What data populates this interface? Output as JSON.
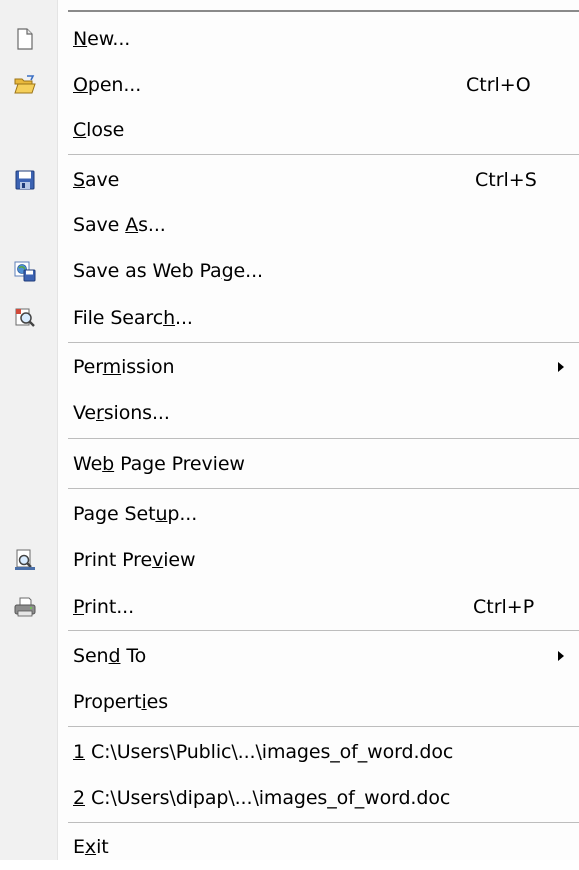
{
  "menu": {
    "items": [
      {
        "id": "new",
        "pre": "",
        "u": "N",
        "post": "ew...",
        "shortcut": "",
        "icon": "new-document-icon",
        "submenu": false
      },
      {
        "id": "open",
        "pre": "",
        "u": "O",
        "post": "pen...",
        "shortcut": "Ctrl+O",
        "icon": "open-folder-icon",
        "submenu": false
      },
      {
        "id": "close",
        "pre": "",
        "u": "C",
        "post": "lose",
        "shortcut": "",
        "icon": "",
        "submenu": false
      },
      {
        "id": "save",
        "pre": "",
        "u": "S",
        "post": "ave",
        "shortcut": "Ctrl+S",
        "icon": "save-disk-icon",
        "submenu": false
      },
      {
        "id": "save-as",
        "pre": "Save ",
        "u": "A",
        "post": "s...",
        "shortcut": "",
        "icon": "",
        "submenu": false
      },
      {
        "id": "save-as-web-page",
        "pre": "Save as Web Pa",
        "u": "g",
        "post": "e...",
        "shortcut": "",
        "icon": "save-web-page-icon",
        "submenu": false
      },
      {
        "id": "file-search",
        "pre": "File Searc",
        "u": "h",
        "post": "...",
        "shortcut": "",
        "icon": "file-search-icon",
        "submenu": false
      },
      {
        "id": "permission",
        "pre": "Per",
        "u": "m",
        "post": "ission",
        "shortcut": "",
        "icon": "",
        "submenu": true
      },
      {
        "id": "versions",
        "pre": "Ve",
        "u": "r",
        "post": "sions...",
        "shortcut": "",
        "icon": "",
        "submenu": false
      },
      {
        "id": "web-page-preview",
        "pre": "We",
        "u": "b",
        "post": " Page Preview",
        "shortcut": "",
        "icon": "",
        "submenu": false
      },
      {
        "id": "page-setup",
        "pre": "Page Set",
        "u": "u",
        "post": "p...",
        "shortcut": "",
        "icon": "",
        "submenu": false
      },
      {
        "id": "print-preview",
        "pre": "Print Pre",
        "u": "v",
        "post": "iew",
        "shortcut": "",
        "icon": "print-preview-icon",
        "submenu": false
      },
      {
        "id": "print",
        "pre": "",
        "u": "P",
        "post": "rint...",
        "shortcut": "Ctrl+P",
        "icon": "printer-icon",
        "submenu": false
      },
      {
        "id": "send-to",
        "pre": "Sen",
        "u": "d",
        "post": " To",
        "shortcut": "",
        "icon": "",
        "submenu": true
      },
      {
        "id": "properties",
        "pre": "Propert",
        "u": "i",
        "post": "es",
        "shortcut": "",
        "icon": "",
        "submenu": false
      },
      {
        "id": "recent-1",
        "pre": "",
        "u": "1",
        "post": " C:\\Users\\Public\\...\\images_of_word.doc",
        "shortcut": "",
        "icon": "",
        "submenu": false
      },
      {
        "id": "recent-2",
        "pre": "",
        "u": "2",
        "post": " C:\\Users\\dipap\\...\\images_of_word.doc",
        "shortcut": "",
        "icon": "",
        "submenu": false
      },
      {
        "id": "exit",
        "pre": "E",
        "u": "x",
        "post": "it",
        "shortcut": "",
        "icon": "",
        "submenu": false
      }
    ]
  }
}
